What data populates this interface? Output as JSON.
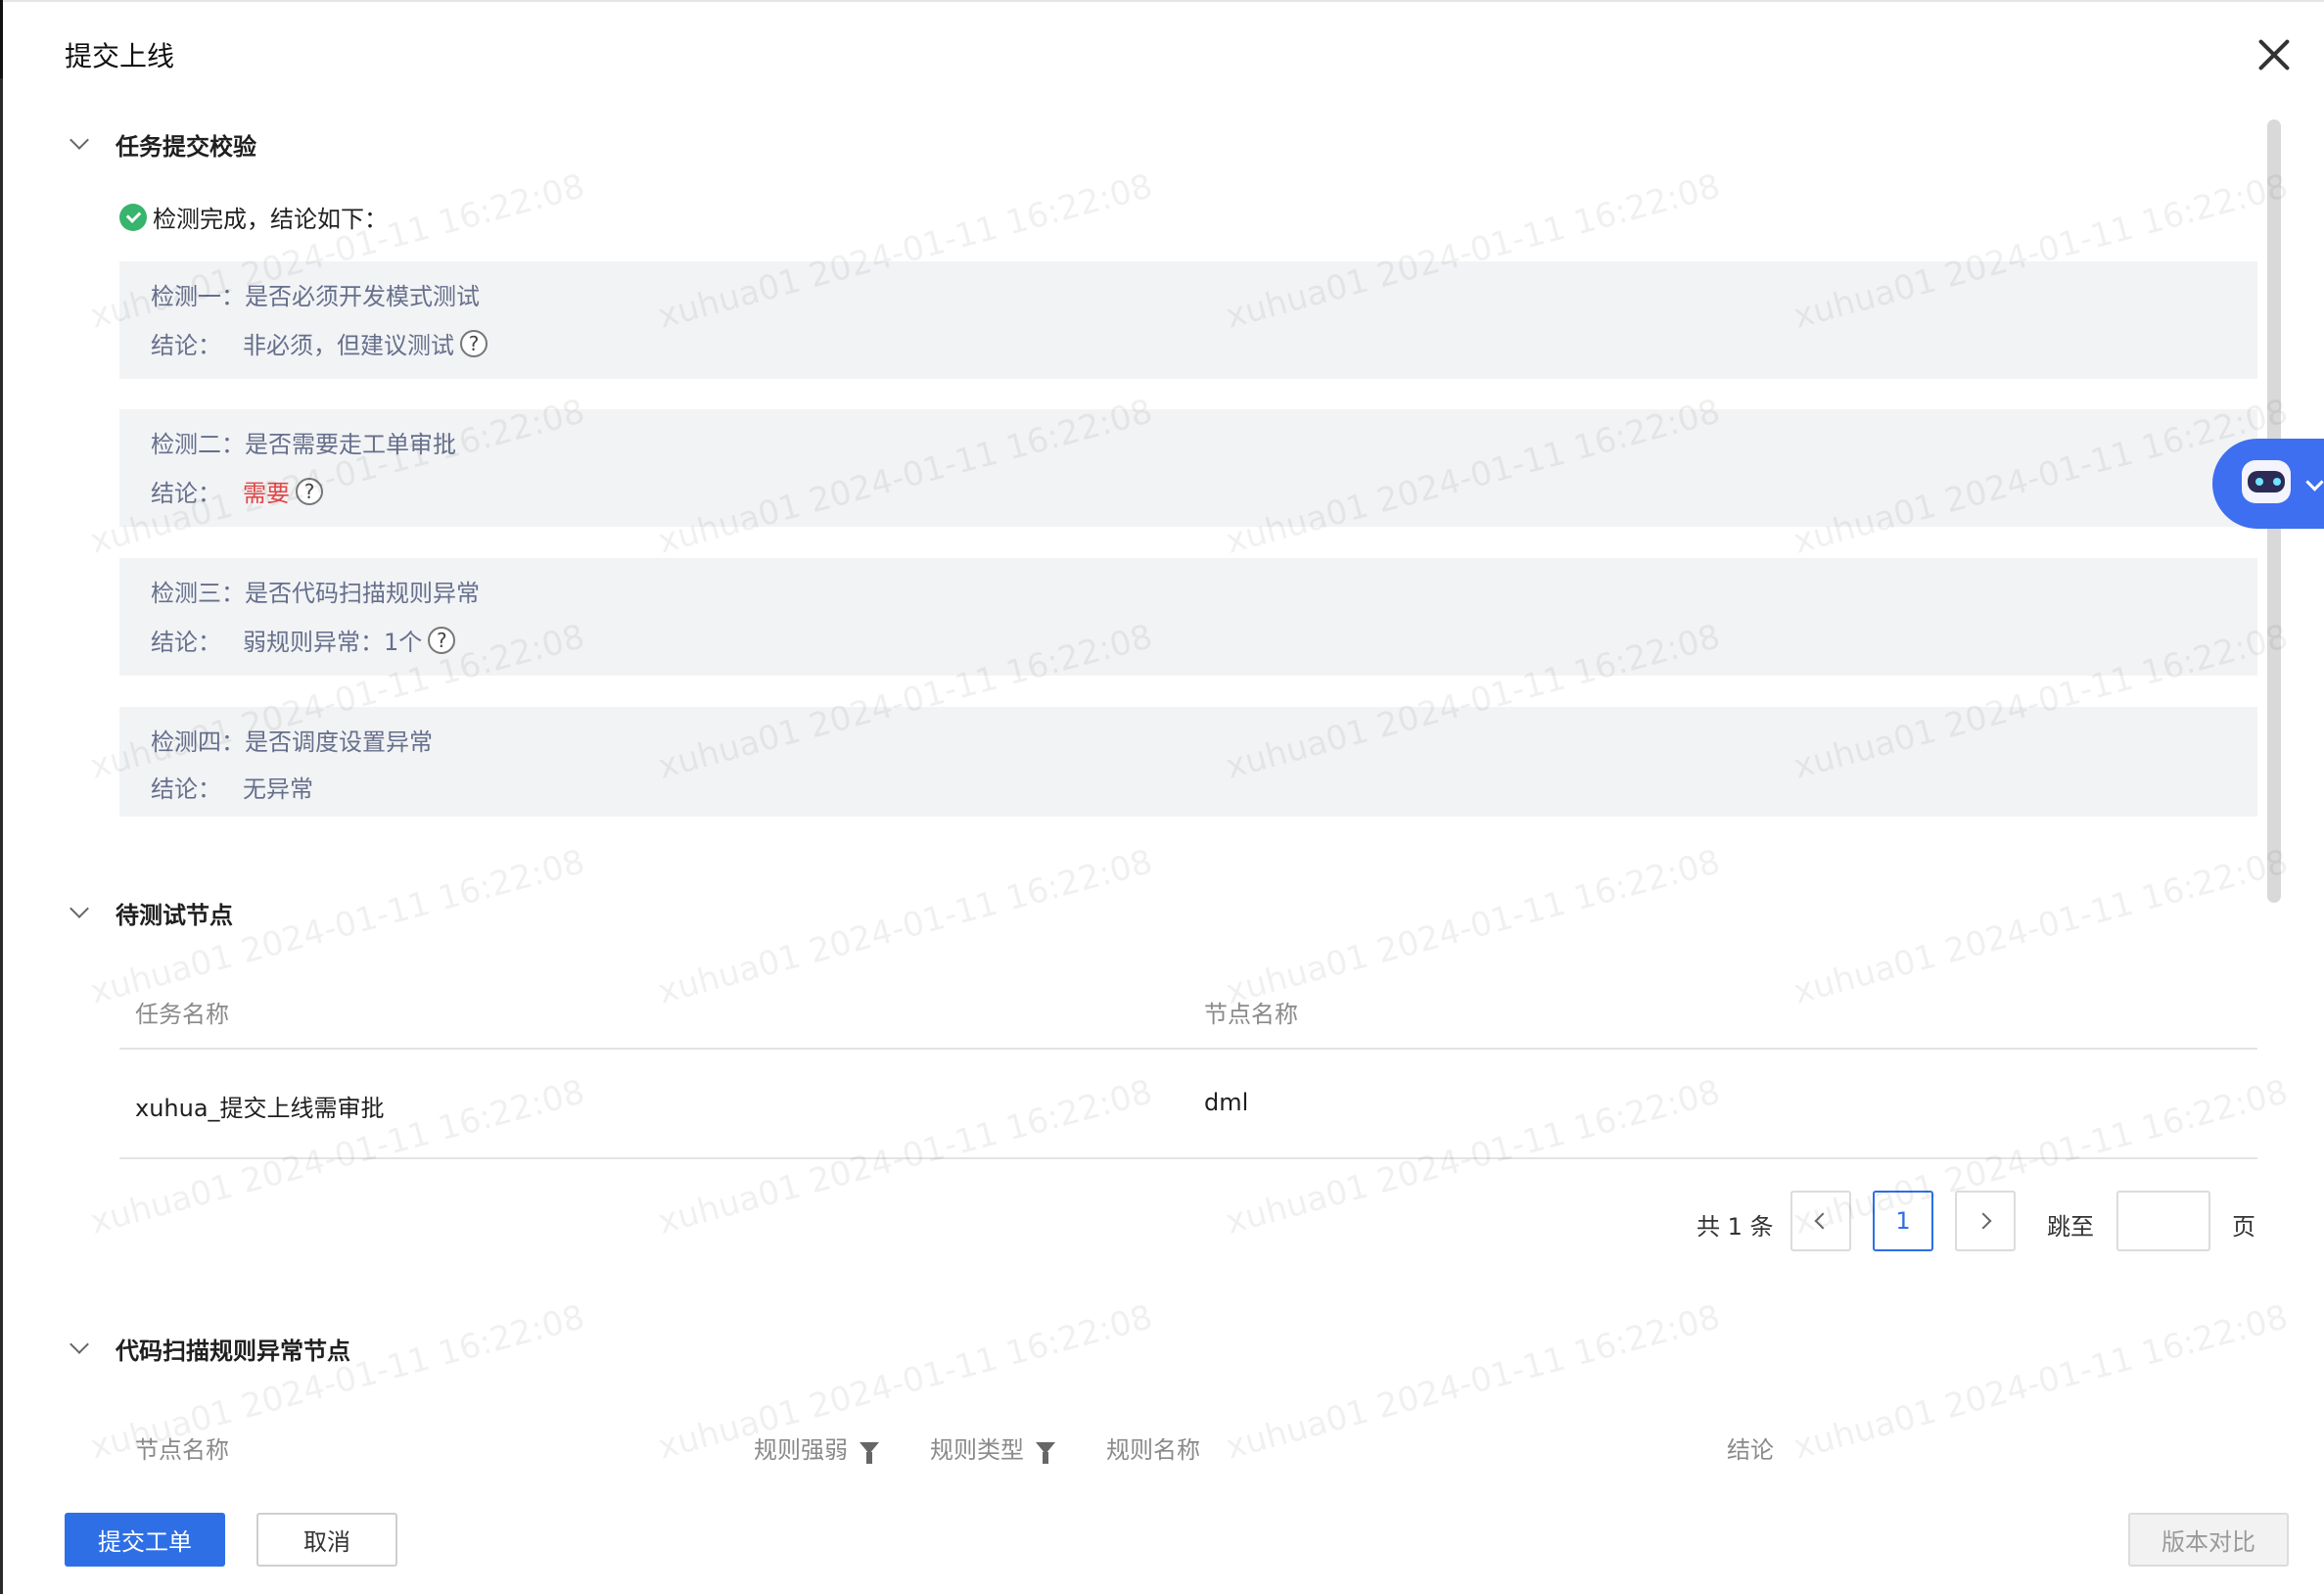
{
  "dialog": {
    "title": "提交上线",
    "close_icon": "close-icon"
  },
  "watermark": "xuhua01 2024-01-11 16:22:08",
  "sections": {
    "check": {
      "title": "任务提交校验",
      "status_text": "检测完成，结论如下：",
      "conclusion_label": "结论：",
      "items": [
        {
          "title": "检测一：是否必须开发模式测试",
          "value": "非必须，但建议测试",
          "help": "?"
        },
        {
          "title": "检测二：是否需要走工单审批",
          "value": "需要",
          "help": "?"
        },
        {
          "title": "检测三：是否代码扫描规则异常",
          "value": "弱规则异常：1个",
          "help": "?"
        },
        {
          "title": "检测四：是否调度设置异常",
          "value": "无异常"
        }
      ]
    },
    "nodes": {
      "title": "待测试节点",
      "columns": [
        "任务名称",
        "节点名称"
      ],
      "rows": [
        {
          "task": "xuhua_提交上线需审批",
          "node": "dml"
        }
      ],
      "pagination": {
        "total_text": "共 1 条",
        "current_page": "1",
        "jump_label": "跳至",
        "page_label": "页"
      }
    },
    "scan": {
      "title": "代码扫描规则异常节点",
      "columns": [
        "节点名称",
        "规则强弱",
        "规则类型",
        "规则名称",
        "结论"
      ]
    }
  },
  "footer": {
    "submit_label": "提交工单",
    "cancel_label": "取消",
    "compare_label": "版本对比"
  },
  "colors": {
    "primary": "#2e6fe6",
    "success": "#37b46d",
    "danger": "#e54545",
    "panel_bg": "#f2f3f5"
  }
}
